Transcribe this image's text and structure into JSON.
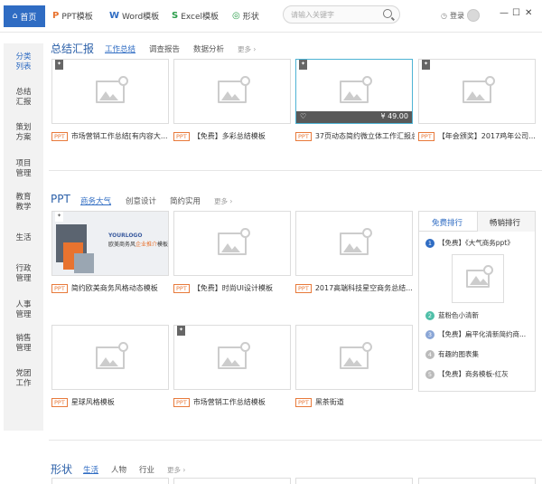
{
  "topbar": {
    "home_label": "首页",
    "tabs": [
      {
        "icon": "P",
        "label": "PPT模板",
        "color": "#e8732f"
      },
      {
        "icon": "W",
        "label": "Word模板",
        "color": "#2f6cc3"
      },
      {
        "icon": "S",
        "label": "Excel模板",
        "color": "#2a9d4a"
      },
      {
        "icon": "◎",
        "label": "形状",
        "color": "#2a9d4a"
      }
    ],
    "search_placeholder": "请输入关键字",
    "login_label": "登录",
    "window_controls": [
      "—",
      "☐",
      "✕"
    ]
  },
  "sidebar": {
    "items": [
      {
        "label": "分类\n列表",
        "active": true
      },
      {
        "label": "总结\n汇报"
      },
      {
        "label": "策划\n方案"
      },
      {
        "label": "项目\n管理"
      },
      {
        "label": "教育\n教学"
      },
      {
        "label": "生活"
      },
      {
        "label": "行政\n管理"
      },
      {
        "label": "人事\n管理"
      },
      {
        "label": "销售\n管理"
      },
      {
        "label": "党团\n工作"
      }
    ]
  },
  "sections": {
    "summary": {
      "title": "总结汇报",
      "subtabs": [
        "工作总结",
        "调查报告",
        "数据分析"
      ],
      "more": "更多 ›",
      "cards": [
        {
          "caption": "市场营销工作总结[有内容大...",
          "tag": "PPT"
        },
        {
          "caption": "【免费】多彩总结模板",
          "tag": "PPT"
        },
        {
          "caption": "37页动态简约微立体工作汇报总...",
          "tag": "PPT",
          "price": "¥ 49.00"
        },
        {
          "caption": "【年会颁奖】2017鸡年公司...",
          "tag": "PPT"
        }
      ]
    },
    "ppt": {
      "title": "PPT",
      "subtabs": [
        "商务大气",
        "创意设计",
        "简约实用"
      ],
      "more": "更多 ›",
      "featured": {
        "logo": "YOURLOGO",
        "text_a": "欧美商务风",
        "text_b": "企业推介",
        "text_c": "模板"
      },
      "cards": [
        {
          "caption": "简约欧美商务风格动态模板",
          "tag": "PPT"
        },
        {
          "caption": "【免费】时尚UI设计模板",
          "tag": "PPT"
        },
        {
          "caption": "2017高端科技星空商务总结...",
          "tag": "PPT"
        },
        {
          "caption": "星球风格模板",
          "tag": "PPT"
        },
        {
          "caption": "市场营销工作总结模板",
          "tag": "PPT"
        },
        {
          "caption": "黑茶街道",
          "tag": "PPT"
        }
      ]
    },
    "shapes": {
      "title": "形状",
      "subtabs": [
        "生活",
        "人物",
        "行业"
      ],
      "more": "更多 ›"
    }
  },
  "ranking": {
    "tabs": [
      "免费排行",
      "畅销排行"
    ],
    "items": [
      {
        "num": "1",
        "label": "【免费】《大气商务ppt》",
        "color": "#2f6cc3"
      },
      {
        "num": "2",
        "label": "蓝粉色小清新",
        "color": "#4fbfa8"
      },
      {
        "num": "3",
        "label": "【免费】扁平化清新简约商...",
        "color": "#8aa6d6"
      },
      {
        "num": "4",
        "label": "有趣的图表集",
        "color": "#bbbbbb"
      },
      {
        "num": "5",
        "label": "【免费】商务模板-红灰",
        "color": "#bbbbbb"
      }
    ]
  },
  "colors": {
    "accent": "#2f6cc3",
    "tag": "#e87a3b"
  }
}
